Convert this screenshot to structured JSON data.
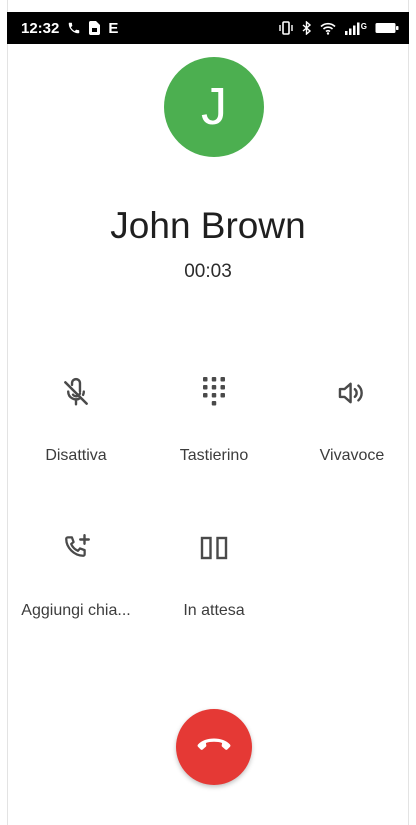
{
  "status_bar": {
    "time": "12:32",
    "network_label": "E",
    "signal_label": "G"
  },
  "contact": {
    "initial": "J",
    "name": "John Brown",
    "duration": "00:03",
    "avatar_color": "#4caf50"
  },
  "controls": {
    "mute_label": "Disattiva",
    "keypad_label": "Tastierino",
    "speaker_label": "Vivavoce",
    "add_call_label": "Aggiungi chia...",
    "hold_label": "In attesa"
  },
  "icons": {
    "mute": "mic-off-icon",
    "keypad": "dialpad-icon",
    "speaker": "volume-icon",
    "add_call": "add-call-icon",
    "hold": "pause-icon",
    "end_call": "phone-hangup-icon"
  },
  "colors": {
    "end_call": "#e53935",
    "icon": "#4a4a4a"
  }
}
